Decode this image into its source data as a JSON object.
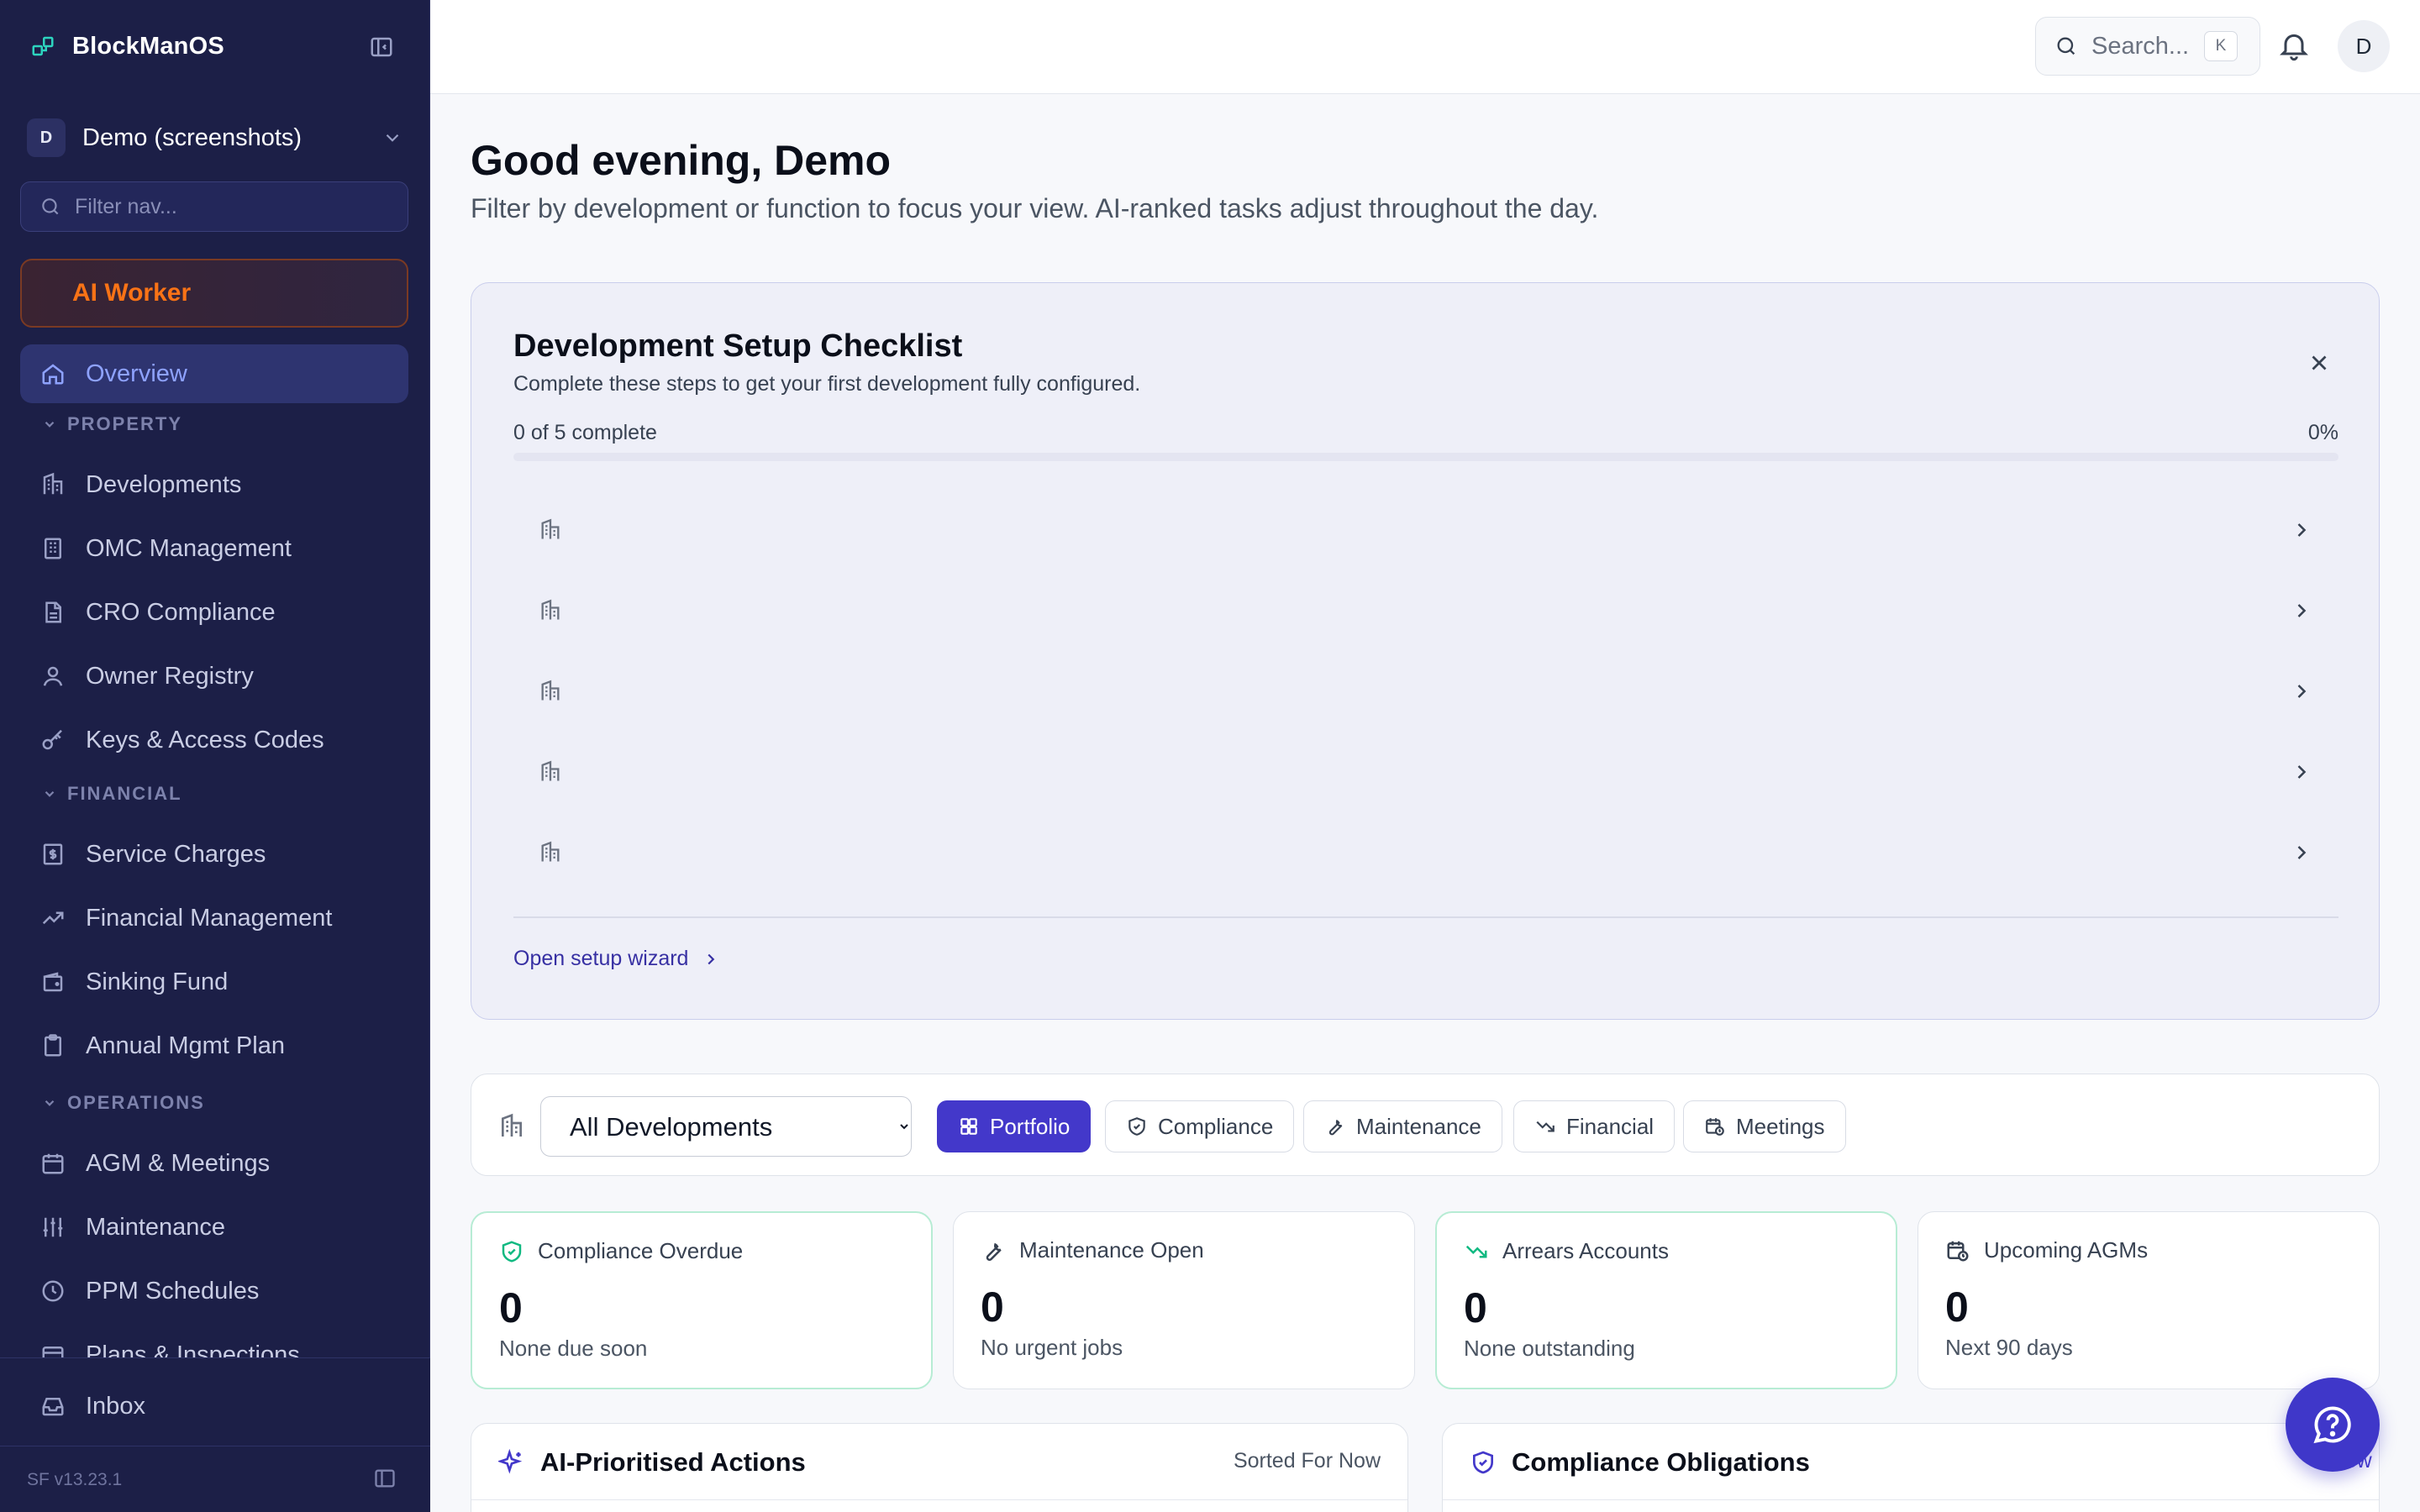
{
  "sidebar": {
    "brand": "BlockManOS",
    "org": {
      "initial": "D",
      "name": "Demo (screenshots)"
    },
    "filter_placeholder": "Filter nav...",
    "ai_worker": "AI Worker",
    "overview": "Overview",
    "sections": {
      "property": "PROPERTY",
      "financial": "FINANCIAL",
      "operations": "OPERATIONS"
    },
    "property_items": [
      "Developments",
      "OMC Management",
      "CRO Compliance",
      "Owner Registry",
      "Keys & Access Codes"
    ],
    "financial_items": [
      "Service Charges",
      "Financial Management",
      "Sinking Fund",
      "Annual Mgmt Plan"
    ],
    "operations_items": [
      "AGM & Meetings",
      "Maintenance",
      "PPM Schedules",
      "Plans & Inspections"
    ],
    "inbox": "Inbox",
    "version": "SF v13.23.1"
  },
  "topbar": {
    "search_label": "Search...",
    "search_shortcut": "K",
    "user_initial": "D"
  },
  "main": {
    "greeting": "Good evening, Demo",
    "subtitle": "Filter by development or function to focus your view. AI-ranked tasks adjust throughout the day."
  },
  "checklist": {
    "title": "Development Setup Checklist",
    "description": "Complete these steps to get your first development fully configured.",
    "progress_label": "0 of 5 complete",
    "percent": "0%",
    "progress_fraction": 0,
    "rows": [
      "",
      "",
      "",
      "",
      ""
    ],
    "wizard_link": "Open setup wizard"
  },
  "filters": {
    "development_selected": "All Developments",
    "tabs": [
      "Portfolio",
      "Compliance",
      "Maintenance",
      "Financial",
      "Meetings"
    ],
    "active_tab": "Portfolio"
  },
  "stats": [
    {
      "label": "Compliance Overdue",
      "value": "0",
      "note": "None due soon"
    },
    {
      "label": "Maintenance Open",
      "value": "0",
      "note": "No urgent jobs"
    },
    {
      "label": "Arrears Accounts",
      "value": "0",
      "note": "None outstanding"
    },
    {
      "label": "Upcoming AGMs",
      "value": "0",
      "note": "Next 90 days"
    }
  ],
  "panels": {
    "actions": {
      "title": "AI-Prioritised Actions",
      "sort": "Sorted For Now"
    },
    "compliance": {
      "title": "Compliance Obligations",
      "link": "View"
    }
  },
  "colors": {
    "sidebar_bg": "#1c1f47",
    "accent": "#4338ca",
    "ai_worker_orange": "#f97316",
    "success_green": "#10b981"
  }
}
